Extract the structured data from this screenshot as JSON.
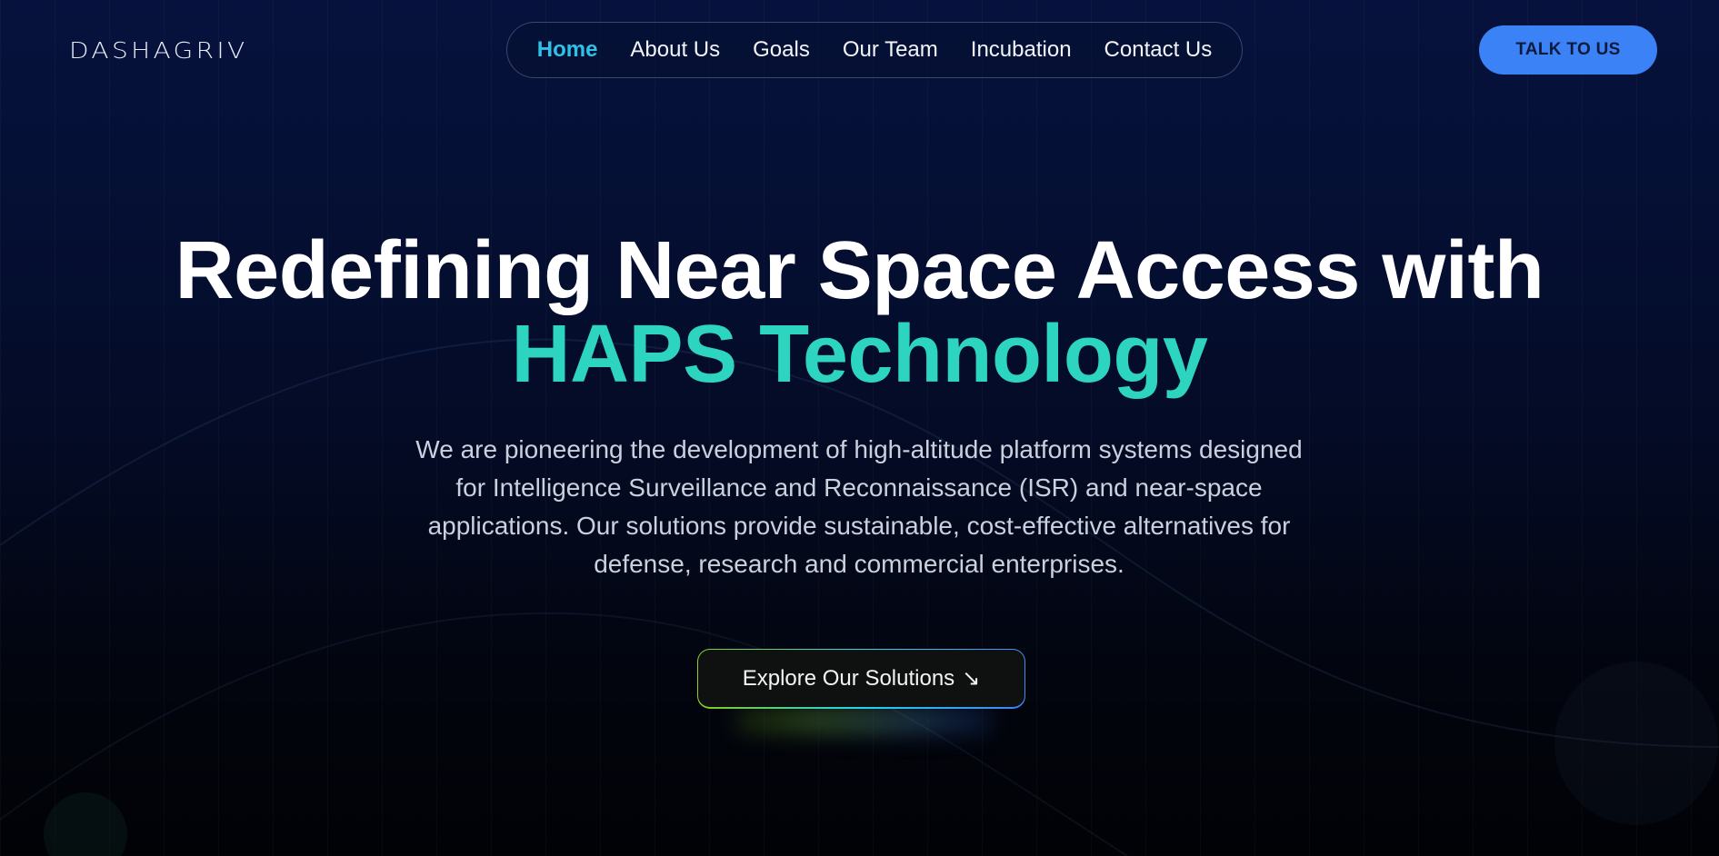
{
  "brand": {
    "logo_text": "DASHAGRIV"
  },
  "nav": {
    "items": [
      {
        "label": "Home",
        "active": true
      },
      {
        "label": "About Us",
        "active": false
      },
      {
        "label": "Goals",
        "active": false
      },
      {
        "label": "Our Team",
        "active": false
      },
      {
        "label": "Incubation",
        "active": false
      },
      {
        "label": "Contact Us",
        "active": false
      }
    ]
  },
  "header": {
    "cta_label": "TALK TO US"
  },
  "hero": {
    "title_line1": "Redefining Near Space Access with",
    "title_line2": "HAPS Technology",
    "description": "We are pioneering the development of high-altitude platform systems designed for Intelligence Surveillance and Reconnaissance (ISR) and near-space applications. Our solutions provide sustainable, cost-effective alternatives for defense, research and commercial enterprises.",
    "button_label": "Explore Our Solutions",
    "button_icon": "arrow-down-right-icon"
  },
  "colors": {
    "accent_teal": "#2dd4bf",
    "nav_active": "#2fc1e6",
    "cta_blue": "#3b82f6",
    "background_top": "#06123d",
    "background_bottom": "#010206"
  }
}
